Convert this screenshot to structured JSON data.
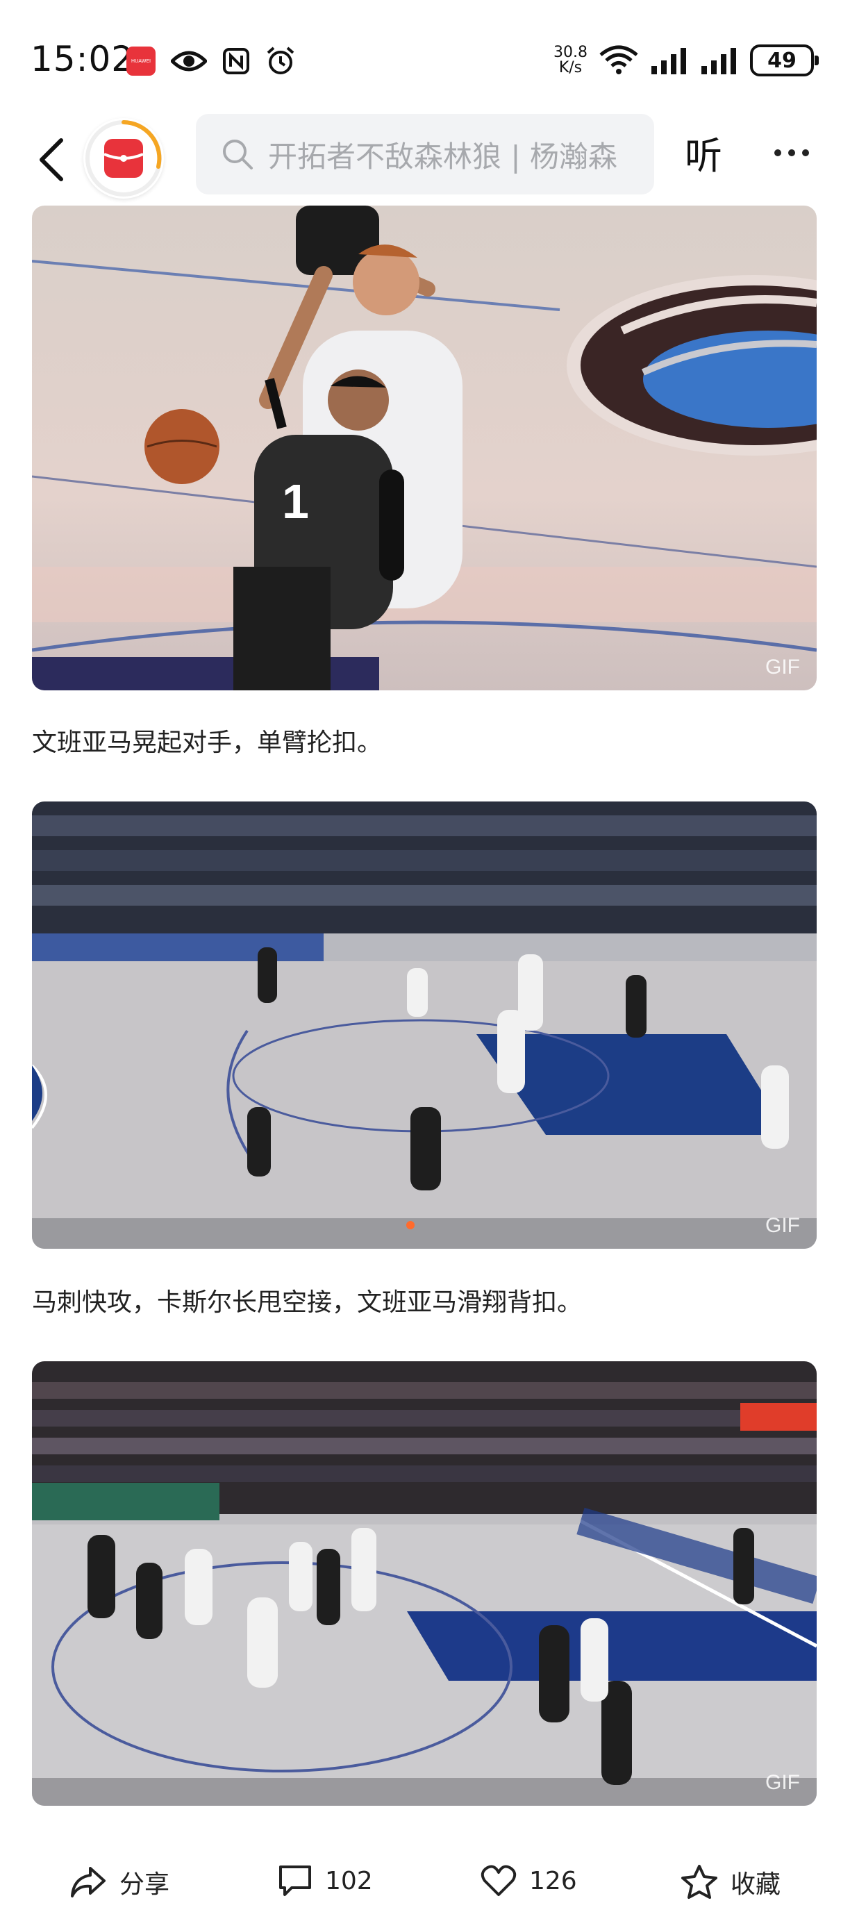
{
  "status_bar": {
    "time": "15:02",
    "net_speed_value": "30.8",
    "net_speed_unit": "K/s",
    "battery": "49",
    "icons": [
      "huawei-app-icon",
      "eye-icon",
      "nfc-icon",
      "alarm-icon",
      "wifi-icon",
      "signal-icon",
      "signal-icon",
      "battery-icon"
    ],
    "huawei_badge_text": "HUAWEI"
  },
  "nav": {
    "search_placeholder": "开拓者不敌森林狼 | 杨瀚森",
    "listen_label": "听",
    "accent_color": "#f5a623"
  },
  "content": {
    "gif_label": "GIF",
    "captions": [
      "文班亚马晃起对手，单臂抡扣。",
      "马刺快攻，卡斯尔长甩空接，文班亚马滑翔背扣。"
    ]
  },
  "bottom_bar": {
    "share_label": "分享",
    "comment_count": "102",
    "like_count": "126",
    "favorite_label": "收藏"
  }
}
